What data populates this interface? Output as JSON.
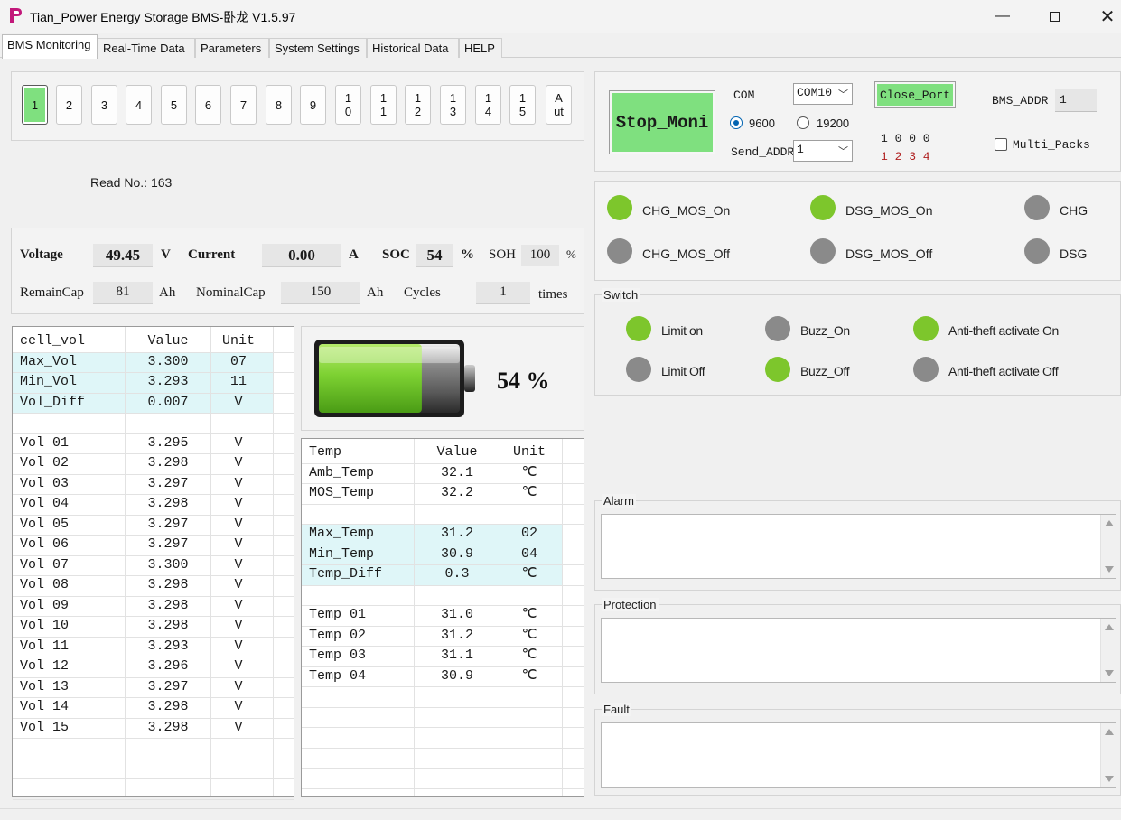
{
  "window": {
    "title": "Tian_Power Energy Storage BMS-卧龙 V1.5.97"
  },
  "tabs": [
    {
      "label": "BMS Monitoring"
    },
    {
      "label": "Real-Time Data"
    },
    {
      "label": "Parameters"
    },
    {
      "label": "System Settings"
    },
    {
      "label": "Historical Data"
    },
    {
      "label": "HELP"
    }
  ],
  "pack_buttons": [
    "1",
    "2",
    "3",
    "4",
    "5",
    "6",
    "7",
    "8",
    "9",
    "10",
    "11",
    "12",
    "13",
    "14",
    "15",
    "Aut"
  ],
  "read_no": {
    "label": "Read No.:",
    "value": "163"
  },
  "summary": {
    "voltage_label": "Voltage",
    "voltage": "49.45",
    "voltage_unit": "V",
    "current_label": "Current",
    "current": "0.00",
    "current_unit": "A",
    "soc_label": "SOC",
    "soc": "54",
    "soc_unit": "%",
    "soh_label": "SOH",
    "soh": "100",
    "soh_unit": "%",
    "remaincap_label": "RemainCap",
    "remaincap": "81",
    "remaincap_unit": "Ah",
    "nominalcap_label": "NominalCap",
    "nominalcap": "150",
    "nominalcap_unit": "Ah",
    "cycles_label": "Cycles",
    "cycles": "1",
    "cycles_unit": "times"
  },
  "battery": {
    "percent_text": "54 %",
    "level": 0.54
  },
  "cell_table": {
    "headers": [
      "cell_vol",
      "Value",
      "Unit"
    ],
    "summary_rows": [
      [
        "Max_Vol",
        "3.300",
        "07"
      ],
      [
        "Min_Vol",
        "3.293",
        "11"
      ],
      [
        "Vol_Diff",
        "0.007",
        "V"
      ]
    ],
    "rows": [
      [
        "Vol 01",
        "3.295",
        "V"
      ],
      [
        "Vol 02",
        "3.298",
        "V"
      ],
      [
        "Vol 03",
        "3.297",
        "V"
      ],
      [
        "Vol 04",
        "3.298",
        "V"
      ],
      [
        "Vol 05",
        "3.297",
        "V"
      ],
      [
        "Vol 06",
        "3.297",
        "V"
      ],
      [
        "Vol 07",
        "3.300",
        "V"
      ],
      [
        "Vol 08",
        "3.298",
        "V"
      ],
      [
        "Vol 09",
        "3.298",
        "V"
      ],
      [
        "Vol 10",
        "3.298",
        "V"
      ],
      [
        "Vol 11",
        "3.293",
        "V"
      ],
      [
        "Vol 12",
        "3.296",
        "V"
      ],
      [
        "Vol 13",
        "3.297",
        "V"
      ],
      [
        "Vol 14",
        "3.298",
        "V"
      ],
      [
        "Vol 15",
        "3.298",
        "V"
      ]
    ]
  },
  "temp_table": {
    "headers": [
      "Temp",
      "Value",
      "Unit"
    ],
    "env_rows": [
      [
        "Amb_Temp",
        "32.1",
        "℃"
      ],
      [
        "MOS_Temp",
        "32.2",
        "℃"
      ]
    ],
    "summary_rows": [
      [
        "Max_Temp",
        "31.2",
        "02"
      ],
      [
        "Min_Temp",
        "30.9",
        "04"
      ],
      [
        "Temp_Diff",
        "0.3",
        "℃"
      ]
    ],
    "rows": [
      [
        "Temp 01",
        "31.0",
        "℃"
      ],
      [
        "Temp 02",
        "31.2",
        "℃"
      ],
      [
        "Temp 03",
        "31.1",
        "℃"
      ],
      [
        "Temp 04",
        "30.9",
        "℃"
      ]
    ]
  },
  "connection": {
    "stop_button": "Stop_Moni",
    "com_label": "COM",
    "com_value": "COM10",
    "close_port": "Close_Port",
    "baud_9600": "9600",
    "baud_19200": "19200",
    "baud_selected": "9600",
    "send_addr_label": "Send_ADDR",
    "send_addr_value": "1",
    "bits_top": "1 0 0 0",
    "bits_bottom": "1 2 3 4",
    "bms_addr_label": "BMS_ADDR",
    "bms_addr_value": "1",
    "multi_packs_label": "Multi_Packs",
    "multi_packs_checked": false
  },
  "mos_status": [
    {
      "label": "CHG_MOS_On",
      "on": true
    },
    {
      "label": "DSG_MOS_On",
      "on": true
    },
    {
      "label": "CHG",
      "on": false
    },
    {
      "label": "CHG_MOS_Off",
      "on": false
    },
    {
      "label": "DSG_MOS_Off",
      "on": false
    },
    {
      "label": "DSG",
      "on": false
    }
  ],
  "switch_group": {
    "title": "Switch",
    "items": [
      {
        "label": "Limit on",
        "on": true
      },
      {
        "label": "Buzz_On",
        "on": false
      },
      {
        "label": "Anti-theft activate On",
        "on": true
      },
      {
        "label": "Limit Off",
        "on": false
      },
      {
        "label": "Buzz_Off",
        "on": true
      },
      {
        "label": "Anti-theft activate Off",
        "on": false
      }
    ]
  },
  "logs": {
    "alarm": "Alarm",
    "protection": "Protection",
    "fault": "Fault"
  },
  "colors": {
    "led_on": "#7dc62c",
    "led_off": "#8a8a8a",
    "active_button": "#7fe07f",
    "highlight_row": "#dff6f8"
  }
}
